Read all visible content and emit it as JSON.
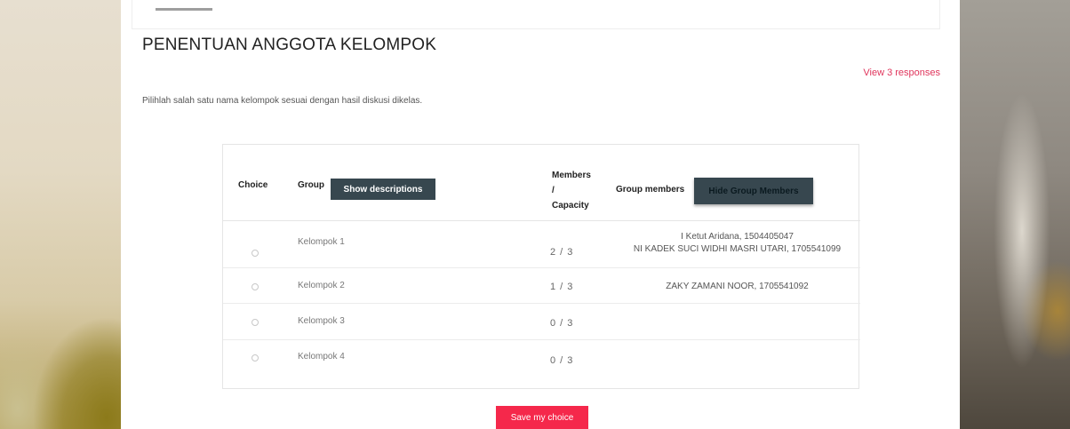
{
  "page": {
    "title": "PENENTUAN ANGGOTA KELOMPOK",
    "responses_link": "View 3 responses",
    "intro": "Pilihlah salah satu nama kelompok sesuai dengan hasil diskusi dikelas."
  },
  "table": {
    "headers": {
      "choice": "Choice",
      "group": "Group",
      "show_descriptions": "Show descriptions",
      "members_line1": "Members",
      "members_line2": "/",
      "members_line3": "Capacity",
      "group_members": "Group members",
      "hide_group_members": "Hide Group Members"
    },
    "rows": [
      {
        "group": "Kelompok 1",
        "capacity": "2 / 3",
        "member1": "I Ketut Aridana, 1504405047",
        "member2": "NI KADEK SUCI WIDHI MASRI UTARI, 1705541099"
      },
      {
        "group": "Kelompok 2",
        "capacity": "1 / 3",
        "member1": "ZAKY ZAMANI NOOR, 1705541092",
        "member2": ""
      },
      {
        "group": "Kelompok 3",
        "capacity": "0 / 3",
        "member1": "",
        "member2": ""
      },
      {
        "group": "Kelompok 4",
        "capacity": "0 / 3",
        "member1": "",
        "member2": ""
      }
    ]
  },
  "actions": {
    "save": "Save my choice"
  },
  "colors": {
    "accent": "#f5284b",
    "link": "#e0355c",
    "dark_button": "#37474f"
  }
}
